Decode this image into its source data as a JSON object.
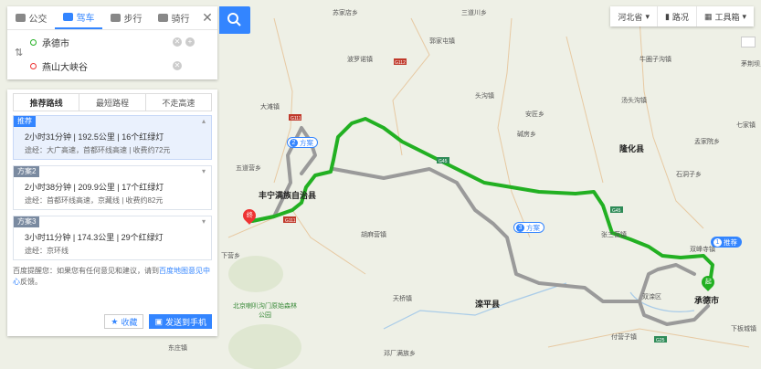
{
  "modes": [
    {
      "label": "公交",
      "icon": "bus-icon"
    },
    {
      "label": "驾车",
      "icon": "car-icon",
      "active": true
    },
    {
      "label": "步行",
      "icon": "walk-icon"
    },
    {
      "label": "骑行",
      "icon": "bike-icon"
    }
  ],
  "origin": "承德市",
  "destination": "燕山大峡谷",
  "tabs": [
    "推荐路线",
    "最短路程",
    "不走高速"
  ],
  "routes": [
    {
      "tag": "推荐",
      "time": "2小时31分钟",
      "distance": "192.5公里",
      "lights": "16个红绿灯",
      "via": "途经：大广高速，首都环线高速",
      "toll": "收费约72元"
    },
    {
      "tag": "方案2",
      "time": "2小时38分钟",
      "distance": "209.9公里",
      "lights": "17个红绿灯",
      "via": "途经：首都环线高速，京藏线",
      "toll": "收费约82元"
    },
    {
      "tag": "方案3",
      "time": "3小时11分钟",
      "distance": "174.3公里",
      "lights": "29个红绿灯",
      "via": "途经：京环线",
      "toll": ""
    }
  ],
  "feedback": {
    "prefix": "百度提醒您：如果您有任何意见和建议，请到",
    "link": "百度地图意见中心",
    "suffix": "反馈。"
  },
  "buttons": {
    "save": "收藏",
    "send": "发送到手机"
  },
  "toolbar": {
    "region": "河北省",
    "traffic": "路况",
    "tools": "工具箱"
  },
  "map": {
    "cities": [
      "承德市",
      "丰宁满族自治县",
      "滦平县",
      "隆化县",
      "双滦区"
    ],
    "towns": [
      "苏家店乡",
      "三道川乡",
      "五道营乡",
      "大滩镇",
      "下营乡",
      "胡麻营镇",
      "天桥镇",
      "安匠乡",
      "邓厂满族乡",
      "付营子镇",
      "东庄镇",
      "双峰寺镇",
      "孟家院乡",
      "张三营镇",
      "碱房乡",
      "七家镇",
      "茅荆坝乡",
      "下板城镇",
      "头沟镇",
      "汤头沟镇",
      "波罗诺镇",
      "郭家屯镇",
      "石洞子乡",
      "牛圈子沟镇"
    ],
    "park": "北京喇叭沟门原始森林公园",
    "badges": [
      {
        "n": "1",
        "label": "推荐"
      },
      {
        "n": "2",
        "label": "方案"
      },
      {
        "n": "3",
        "label": "方案"
      }
    ],
    "start_label": "起",
    "end_label": "终",
    "roads": [
      "G111",
      "G45",
      "S356",
      "G112",
      "G95",
      "G101",
      "G25"
    ],
    "colors": {
      "recommended": "#22b022",
      "alternate": "#9a9a9a",
      "accent": "#3385ff"
    }
  }
}
